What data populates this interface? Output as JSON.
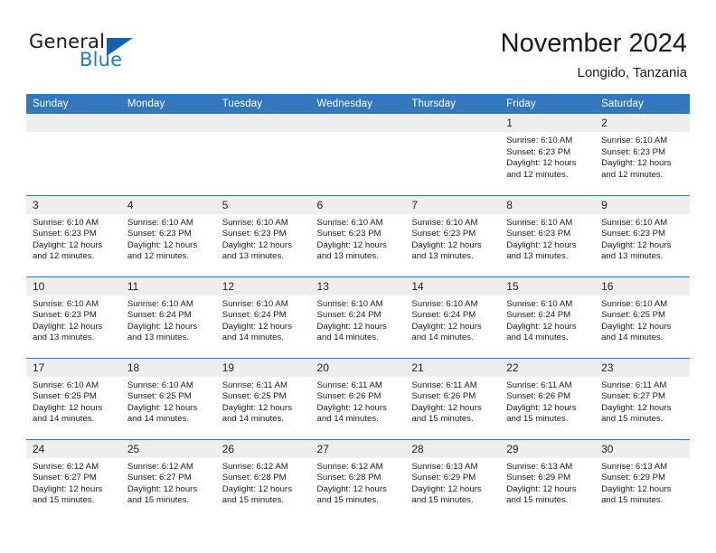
{
  "brand": {
    "name_part1": "General",
    "name_part2": "Blue",
    "accent_color": "#1e7bc8",
    "triangle_color": "#1562a8"
  },
  "header": {
    "title": "November 2024",
    "subtitle": "Longido, Tanzania"
  },
  "theme": {
    "header_row_bg": "#3178be",
    "daynum_bg": "#eeeeee",
    "cell_border": "#3178be",
    "text": "#1a1a1a"
  },
  "weekdays": [
    "Sunday",
    "Monday",
    "Tuesday",
    "Wednesday",
    "Thursday",
    "Friday",
    "Saturday"
  ],
  "weeks": [
    [
      {
        "day": "",
        "empty": true
      },
      {
        "day": "",
        "empty": true
      },
      {
        "day": "",
        "empty": true
      },
      {
        "day": "",
        "empty": true
      },
      {
        "day": "",
        "empty": true
      },
      {
        "day": "1",
        "sunrise": "Sunrise: 6:10 AM",
        "sunset": "Sunset: 6:23 PM",
        "daylight1": "Daylight: 12 hours",
        "daylight2": "and 12 minutes."
      },
      {
        "day": "2",
        "sunrise": "Sunrise: 6:10 AM",
        "sunset": "Sunset: 6:23 PM",
        "daylight1": "Daylight: 12 hours",
        "daylight2": "and 12 minutes."
      }
    ],
    [
      {
        "day": "3",
        "sunrise": "Sunrise: 6:10 AM",
        "sunset": "Sunset: 6:23 PM",
        "daylight1": "Daylight: 12 hours",
        "daylight2": "and 12 minutes."
      },
      {
        "day": "4",
        "sunrise": "Sunrise: 6:10 AM",
        "sunset": "Sunset: 6:23 PM",
        "daylight1": "Daylight: 12 hours",
        "daylight2": "and 12 minutes."
      },
      {
        "day": "5",
        "sunrise": "Sunrise: 6:10 AM",
        "sunset": "Sunset: 6:23 PM",
        "daylight1": "Daylight: 12 hours",
        "daylight2": "and 13 minutes."
      },
      {
        "day": "6",
        "sunrise": "Sunrise: 6:10 AM",
        "sunset": "Sunset: 6:23 PM",
        "daylight1": "Daylight: 12 hours",
        "daylight2": "and 13 minutes."
      },
      {
        "day": "7",
        "sunrise": "Sunrise: 6:10 AM",
        "sunset": "Sunset: 6:23 PM",
        "daylight1": "Daylight: 12 hours",
        "daylight2": "and 13 minutes."
      },
      {
        "day": "8",
        "sunrise": "Sunrise: 6:10 AM",
        "sunset": "Sunset: 6:23 PM",
        "daylight1": "Daylight: 12 hours",
        "daylight2": "and 13 minutes."
      },
      {
        "day": "9",
        "sunrise": "Sunrise: 6:10 AM",
        "sunset": "Sunset: 6:23 PM",
        "daylight1": "Daylight: 12 hours",
        "daylight2": "and 13 minutes."
      }
    ],
    [
      {
        "day": "10",
        "sunrise": "Sunrise: 6:10 AM",
        "sunset": "Sunset: 6:23 PM",
        "daylight1": "Daylight: 12 hours",
        "daylight2": "and 13 minutes."
      },
      {
        "day": "11",
        "sunrise": "Sunrise: 6:10 AM",
        "sunset": "Sunset: 6:24 PM",
        "daylight1": "Daylight: 12 hours",
        "daylight2": "and 13 minutes."
      },
      {
        "day": "12",
        "sunrise": "Sunrise: 6:10 AM",
        "sunset": "Sunset: 6:24 PM",
        "daylight1": "Daylight: 12 hours",
        "daylight2": "and 14 minutes."
      },
      {
        "day": "13",
        "sunrise": "Sunrise: 6:10 AM",
        "sunset": "Sunset: 6:24 PM",
        "daylight1": "Daylight: 12 hours",
        "daylight2": "and 14 minutes."
      },
      {
        "day": "14",
        "sunrise": "Sunrise: 6:10 AM",
        "sunset": "Sunset: 6:24 PM",
        "daylight1": "Daylight: 12 hours",
        "daylight2": "and 14 minutes."
      },
      {
        "day": "15",
        "sunrise": "Sunrise: 6:10 AM",
        "sunset": "Sunset: 6:24 PM",
        "daylight1": "Daylight: 12 hours",
        "daylight2": "and 14 minutes."
      },
      {
        "day": "16",
        "sunrise": "Sunrise: 6:10 AM",
        "sunset": "Sunset: 6:25 PM",
        "daylight1": "Daylight: 12 hours",
        "daylight2": "and 14 minutes."
      }
    ],
    [
      {
        "day": "17",
        "sunrise": "Sunrise: 6:10 AM",
        "sunset": "Sunset: 6:25 PM",
        "daylight1": "Daylight: 12 hours",
        "daylight2": "and 14 minutes."
      },
      {
        "day": "18",
        "sunrise": "Sunrise: 6:10 AM",
        "sunset": "Sunset: 6:25 PM",
        "daylight1": "Daylight: 12 hours",
        "daylight2": "and 14 minutes."
      },
      {
        "day": "19",
        "sunrise": "Sunrise: 6:11 AM",
        "sunset": "Sunset: 6:25 PM",
        "daylight1": "Daylight: 12 hours",
        "daylight2": "and 14 minutes."
      },
      {
        "day": "20",
        "sunrise": "Sunrise: 6:11 AM",
        "sunset": "Sunset: 6:26 PM",
        "daylight1": "Daylight: 12 hours",
        "daylight2": "and 14 minutes."
      },
      {
        "day": "21",
        "sunrise": "Sunrise: 6:11 AM",
        "sunset": "Sunset: 6:26 PM",
        "daylight1": "Daylight: 12 hours",
        "daylight2": "and 15 minutes."
      },
      {
        "day": "22",
        "sunrise": "Sunrise: 6:11 AM",
        "sunset": "Sunset: 6:26 PM",
        "daylight1": "Daylight: 12 hours",
        "daylight2": "and 15 minutes."
      },
      {
        "day": "23",
        "sunrise": "Sunrise: 6:11 AM",
        "sunset": "Sunset: 6:27 PM",
        "daylight1": "Daylight: 12 hours",
        "daylight2": "and 15 minutes."
      }
    ],
    [
      {
        "day": "24",
        "sunrise": "Sunrise: 6:12 AM",
        "sunset": "Sunset: 6:27 PM",
        "daylight1": "Daylight: 12 hours",
        "daylight2": "and 15 minutes."
      },
      {
        "day": "25",
        "sunrise": "Sunrise: 6:12 AM",
        "sunset": "Sunset: 6:27 PM",
        "daylight1": "Daylight: 12 hours",
        "daylight2": "and 15 minutes."
      },
      {
        "day": "26",
        "sunrise": "Sunrise: 6:12 AM",
        "sunset": "Sunset: 6:28 PM",
        "daylight1": "Daylight: 12 hours",
        "daylight2": "and 15 minutes."
      },
      {
        "day": "27",
        "sunrise": "Sunrise: 6:12 AM",
        "sunset": "Sunset: 6:28 PM",
        "daylight1": "Daylight: 12 hours",
        "daylight2": "and 15 minutes."
      },
      {
        "day": "28",
        "sunrise": "Sunrise: 6:13 AM",
        "sunset": "Sunset: 6:29 PM",
        "daylight1": "Daylight: 12 hours",
        "daylight2": "and 15 minutes."
      },
      {
        "day": "29",
        "sunrise": "Sunrise: 6:13 AM",
        "sunset": "Sunset: 6:29 PM",
        "daylight1": "Daylight: 12 hours",
        "daylight2": "and 15 minutes."
      },
      {
        "day": "30",
        "sunrise": "Sunrise: 6:13 AM",
        "sunset": "Sunset: 6:29 PM",
        "daylight1": "Daylight: 12 hours",
        "daylight2": "and 15 minutes."
      }
    ]
  ]
}
